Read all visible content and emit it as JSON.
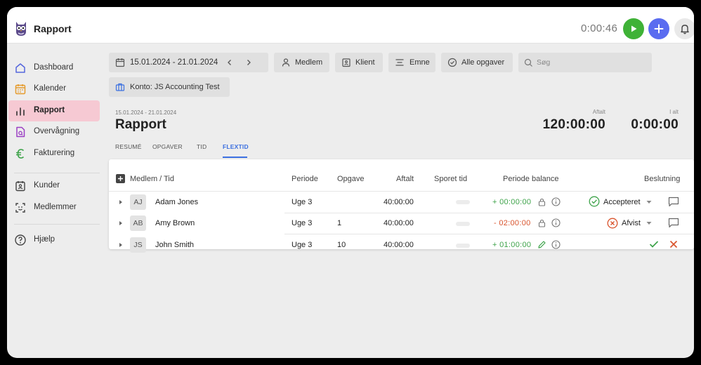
{
  "app": {
    "title": "Rapport",
    "timer": "0:00:46"
  },
  "sidebar": {
    "items": [
      {
        "label": "Dashboard",
        "icon": "home-icon"
      },
      {
        "label": "Kalender",
        "icon": "calendar-icon"
      },
      {
        "label": "Rapport",
        "icon": "bar-chart-icon",
        "active": true
      },
      {
        "label": "Overvågning",
        "icon": "monitoring-icon"
      },
      {
        "label": "Fakturering",
        "icon": "euro-icon"
      },
      {
        "label": "Kunder",
        "icon": "contact-card-icon"
      },
      {
        "label": "Medlemmer",
        "icon": "members-icon"
      },
      {
        "label": "Hjælp",
        "icon": "help-icon"
      }
    ]
  },
  "filters": {
    "date_range": "15.01.2024 - 21.01.2024",
    "member": "Medlem",
    "client": "Klient",
    "subject": "Emne",
    "tasks": "Alle opgaver",
    "search_placeholder": "Søg",
    "account": "Konto: JS Accounting Test"
  },
  "report": {
    "range_small": "15.01.2024 - 21.01.2024",
    "title": "Rapport",
    "agreed_label": "Aftalt",
    "agreed_value": "120:00:00",
    "total_label": "I alt",
    "total_value": "0:00:00",
    "tabs": [
      "RESUMÉ",
      "OPGAVER",
      "TID",
      "FLEXTID"
    ],
    "active_tab": "FLEXTID"
  },
  "table": {
    "headers": {
      "member": "Medlem / Tid",
      "period": "Periode",
      "task": "Opgave",
      "agreed": "Aftalt",
      "tracked": "Sporet tid",
      "balance": "Periode balance",
      "decision": "Beslutning"
    },
    "rows": [
      {
        "initials": "AJ",
        "name": "Adam Jones",
        "period": "Uge 3",
        "task": "",
        "agreed": "40:00:00",
        "balance": "+ 00:00:00",
        "balance_type": "positive",
        "lock": "lock-icon",
        "decision": "Accepteret",
        "decision_status": "accepted"
      },
      {
        "initials": "AB",
        "name": "Amy Brown",
        "period": "Uge 3",
        "task": "1",
        "agreed": "40:00:00",
        "balance": "- 02:00:00",
        "balance_type": "negative",
        "lock": "lock-icon",
        "decision": "Afvist",
        "decision_status": "rejected"
      },
      {
        "initials": "JS",
        "name": "John Smith",
        "period": "Uge 3",
        "task": "10",
        "agreed": "40:00:00",
        "balance": "+ 01:00:00",
        "balance_type": "positive",
        "lock": "pencil-icon",
        "decision": "",
        "decision_status": "pending"
      }
    ]
  },
  "colors": {
    "accent": "#3b6fe0",
    "active_nav": "#f6c9d3",
    "play": "#3fb237",
    "add": "#5a6cf0",
    "positive": "#3ea34a",
    "negative": "#d9542d"
  }
}
